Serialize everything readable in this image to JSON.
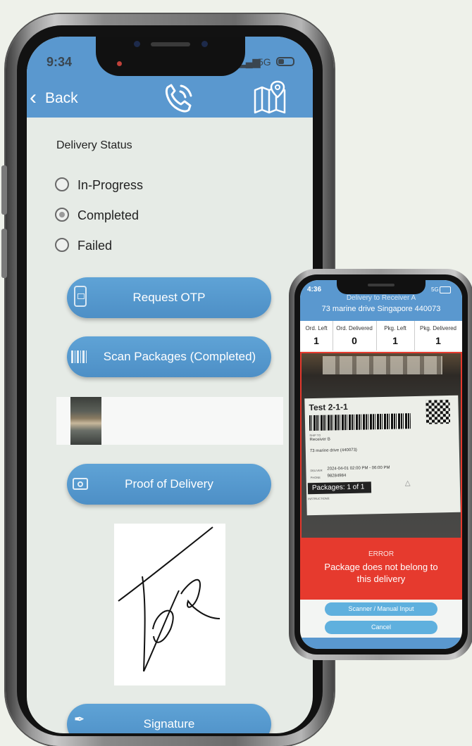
{
  "main_phone": {
    "status_bar": {
      "time": "9:34",
      "signal": "5G"
    },
    "header": {
      "back_label": "Back",
      "phone_icon": "phone-call-icon",
      "map_icon": "map-pin-icon"
    },
    "delivery_status": {
      "title": "Delivery Status",
      "options": [
        {
          "label": "In-Progress",
          "selected": false
        },
        {
          "label": "Completed",
          "selected": true
        },
        {
          "label": "Failed",
          "selected": false
        }
      ]
    },
    "buttons": {
      "request_otp": "Request OTP",
      "scan_packages": "Scan Packages (Completed)",
      "proof_of_delivery": "Proof of Delivery",
      "signature": "Signature"
    },
    "signature_text": "TdR"
  },
  "scanner_phone": {
    "status_bar": {
      "time": "4:36",
      "signal": "5G"
    },
    "header": {
      "title": "Delivery to Receiver A",
      "address": "73 marine drive Singapore 440073"
    },
    "stats": [
      {
        "label": "Ord. Left",
        "value": "1"
      },
      {
        "label": "Ord. Delivered",
        "value": "0"
      },
      {
        "label": "Pkg. Left",
        "value": "1"
      },
      {
        "label": "Pkg. Delivered",
        "value": "1"
      }
    ],
    "label_card": {
      "title": "Test 2-1-1",
      "recipient_caption": "SHIP TO",
      "recipient": "Receiver B",
      "address": "73 marine drive (440073)",
      "deliver_caption": "DELIVER",
      "deliver_value": "2024-04-01  02:00 PM - 06:00 PM",
      "phone_caption": "PHONE",
      "phone_value": "98284984",
      "packages": "Packages: 1 of 1",
      "instructions_caption": "INSTRUCTIONS:"
    },
    "error": {
      "title": "ERROR",
      "message_line1": "Package does not belong to",
      "message_line2": "this delivery"
    },
    "buttons": {
      "scanner": "Scanner / Manual Input",
      "cancel": "Cancel"
    }
  },
  "colors": {
    "accent": "#5a98cf",
    "error": "#e63a2e",
    "background": "#eef1ea"
  }
}
